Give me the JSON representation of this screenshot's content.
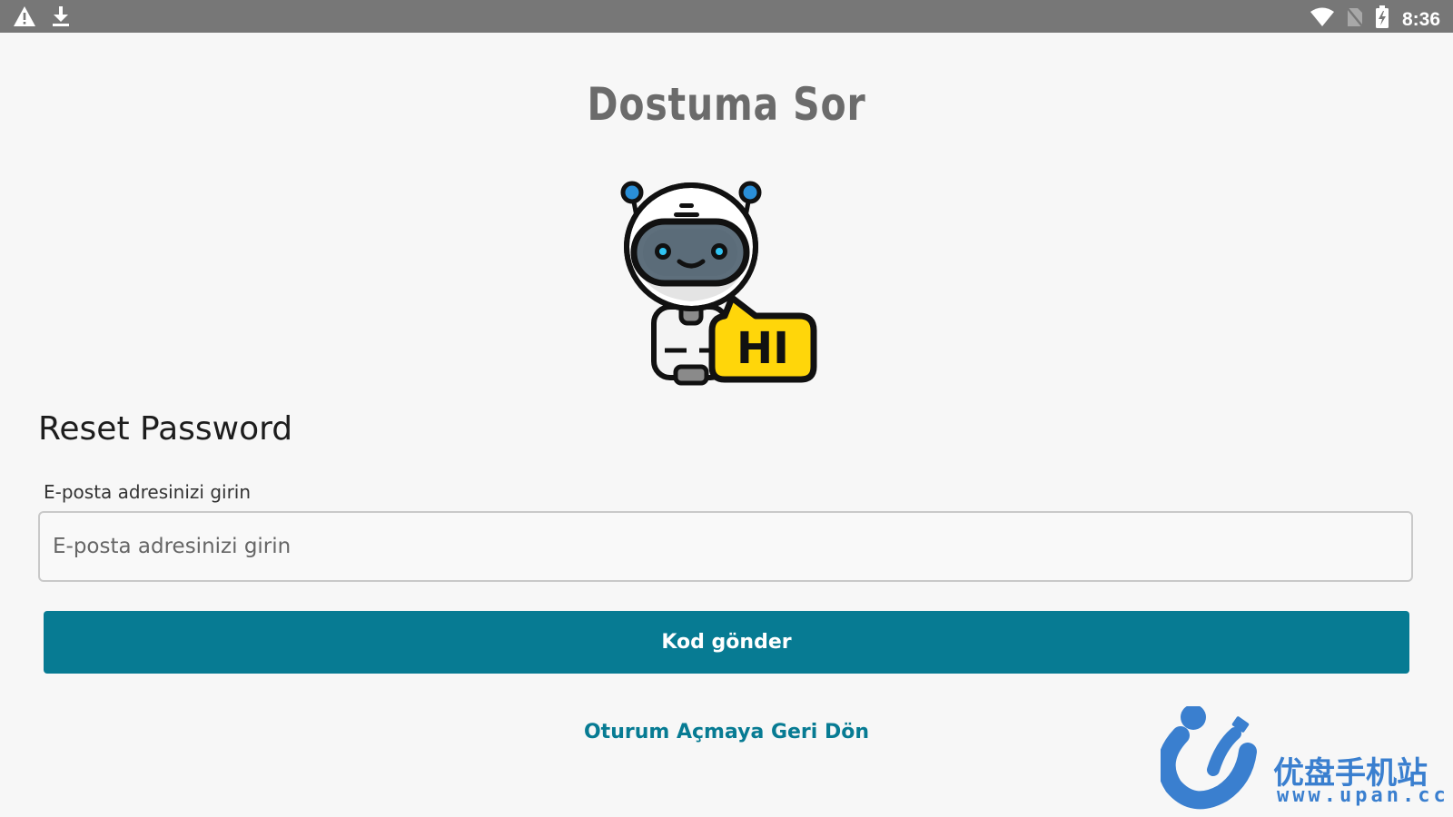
{
  "status_bar": {
    "time": "8:36",
    "left_icons": [
      "warning-icon",
      "download-icon"
    ],
    "right_icons": [
      "wifi-icon",
      "no-sim-icon",
      "battery-charging-icon"
    ]
  },
  "app": {
    "title": "Dostuma Sor",
    "mascot_bubble_text": "HI"
  },
  "form": {
    "heading": "Reset Password",
    "email_label": "E-posta adresinizi girin",
    "email_placeholder": "E-posta adresinizi girin",
    "email_value": "",
    "submit_label": "Kod gönder",
    "back_link": "Oturum Açmaya Geri Dön"
  },
  "watermark": {
    "brand": "优盘手机站",
    "url": "www.upan.cc"
  },
  "colors": {
    "accent": "#077b93",
    "status_bar": "#777777",
    "background": "#f7f7f7",
    "bubble": "#ffd60a",
    "watermark": "#3a7fcf"
  }
}
